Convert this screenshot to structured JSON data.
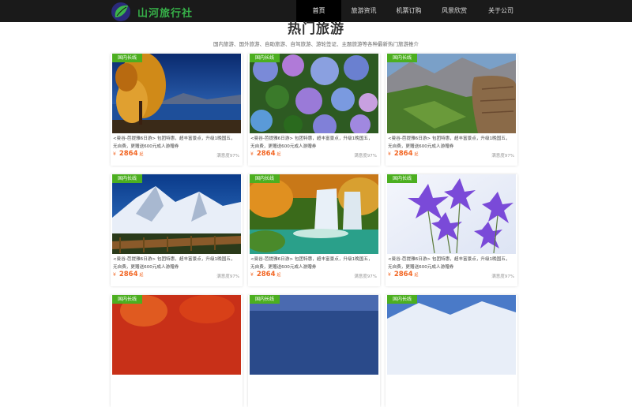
{
  "header": {
    "logo_text": "山河旅行社",
    "nav": [
      "首页",
      "旅游资讯",
      "机票订购",
      "风景欣赏",
      "关于公司"
    ]
  },
  "section": {
    "title": "热门旅游",
    "subtitle": "国内旅游、国外旅游、自助旅游、自驾旅游、游轮签证、主题旅游等各种最新热门旅游推介"
  },
  "cards": [
    {
      "tag": "国内长线",
      "desc": "<曼谷-芭提雅6日游> 包团特惠，超丰富景点，升级1晚国五，无自费，更赠送600元成人游赠券",
      "yen": "¥",
      "price": "2864",
      "unit": "起",
      "satisfaction": "满意度97%"
    },
    {
      "tag": "国内长线",
      "desc": "<曼谷-芭提雅6日游> 包团特惠，超丰富景点，升级1晚国五，无自费，更赠送600元成人游赠券",
      "yen": "¥",
      "price": "2864",
      "unit": "起",
      "satisfaction": "满意度97%"
    },
    {
      "tag": "国内长线",
      "desc": "<曼谷-芭提雅6日游> 包团特惠，超丰富景点，升级1晚国五，无自费，更赠送600元成人游赠券",
      "yen": "¥",
      "price": "2864",
      "unit": "起",
      "satisfaction": "满意度97%"
    },
    {
      "tag": "国内长线",
      "desc": "<曼谷-芭提雅6日游> 包团特惠，超丰富景点，升级1晚国五，无自费，更赠送600元成人游赠券",
      "yen": "¥",
      "price": "2864",
      "unit": "起",
      "satisfaction": "满意度97%"
    },
    {
      "tag": "国内长线",
      "desc": "<曼谷-芭提雅6日游> 包团特惠，超丰富景点，升级1晚国五，无自费，更赠送600元成人游赠券",
      "yen": "¥",
      "price": "2864",
      "unit": "起",
      "satisfaction": "满意度97%"
    },
    {
      "tag": "国内长线",
      "desc": "<曼谷-芭提雅6日游> 包团特惠，超丰富景点，升级1晚国五，无自费，更赠送600元成人游赠券",
      "yen": "¥",
      "price": "2864",
      "unit": "起",
      "satisfaction": "满意度97%"
    },
    {
      "tag": "国内长线"
    },
    {
      "tag": "国内长线"
    },
    {
      "tag": "国内长线"
    }
  ]
}
